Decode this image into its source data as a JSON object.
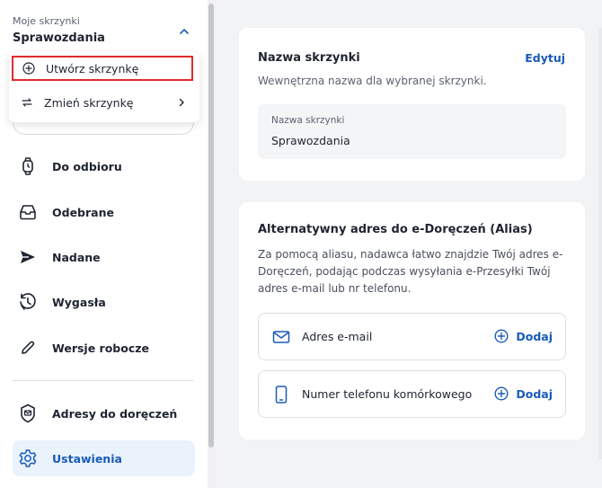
{
  "sidebar": {
    "mailbox_caption": "Moje skrzynki",
    "mailbox_name": "Sprawozdania",
    "dropdown": {
      "create_label": "Utwórz skrzynkę",
      "change_label": "Zmień skrzynkę"
    },
    "nav": [
      {
        "label": "Do odbioru",
        "icon": "watch-icon"
      },
      {
        "label": "Odebrane",
        "icon": "inbox-icon"
      },
      {
        "label": "Nadane",
        "icon": "send-icon"
      },
      {
        "label": "Wygasła",
        "icon": "clock-expired-icon"
      },
      {
        "label": "Wersje robocze",
        "icon": "pencil-icon"
      },
      {
        "label": "Adresy do doręczeń",
        "icon": "badge-icon"
      },
      {
        "label": "Ustawienia",
        "icon": "gear-icon",
        "active": true
      }
    ]
  },
  "name_card": {
    "title": "Nazwa skrzynki",
    "edit_label": "Edytuj",
    "description": "Wewnętrzna nazwa dla wybranej skrzynki.",
    "field_label": "Nazwa skrzynki",
    "field_value": "Sprawozdania"
  },
  "alias_card": {
    "title": "Alternatywny adres do e-Doręczeń (Alias)",
    "description_lines": [
      "Za pomocą aliasu, nadawca łatwo znajdzie Twój adres e-",
      "Doręczeń, podając podczas wysyłania e-Przesyłki Twój",
      "adres e-mail lub nr telefonu."
    ],
    "rows": [
      {
        "label": "Adres e-mail",
        "icon": "envelope-icon",
        "action": "Dodaj"
      },
      {
        "label": "Numer telefonu komórkowego",
        "icon": "phone-icon",
        "action": "Dodaj"
      }
    ]
  },
  "colors": {
    "accent": "#1a5bb8",
    "highlight_border": "#e02b2b",
    "active_nav_bg": "#eaf2fc"
  }
}
